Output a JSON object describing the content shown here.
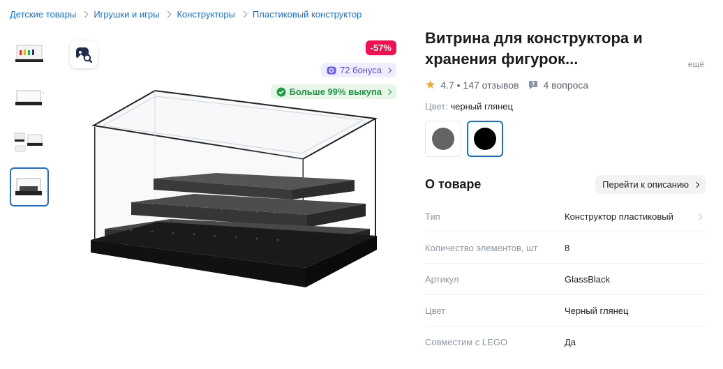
{
  "breadcrumb": [
    "Детские товары",
    "Игрушки и игры",
    "Конструкторы",
    "Пластиковый конструктор"
  ],
  "badges": {
    "discount": "-57%",
    "bonus": "72 бонуса",
    "buyout": "Больше 99% выкупа"
  },
  "product": {
    "title": "Витрина для конструктора и хранения фигурок...",
    "more_label": "ещё",
    "rating": "4.7",
    "reviews": "147 отзывов",
    "questions": "4 вопроса",
    "color_label": "Цвет:",
    "color_value": "черный глянец",
    "swatches": [
      {
        "name": "grey",
        "color": "#646464"
      },
      {
        "name": "black",
        "color": "#000000"
      }
    ]
  },
  "about": {
    "title": "О товаре",
    "button": "Перейти к описанию"
  },
  "specs": [
    {
      "name": "Тип",
      "value": "Конструктор пластиковый"
    },
    {
      "name": "Количество элементов, шт",
      "value": "8"
    },
    {
      "name": "Артикул",
      "value": "GlassBlack"
    },
    {
      "name": "Цвет",
      "value": "Черный глянец"
    },
    {
      "name": "Совместим с LEGO",
      "value": "Да"
    }
  ],
  "colors": {
    "link": "#1a6fd6",
    "discount_bg": "#f1114f",
    "bonus_text": "#5b4de0",
    "buyout_text": "#1d9b3f",
    "star": "#f5a623"
  }
}
